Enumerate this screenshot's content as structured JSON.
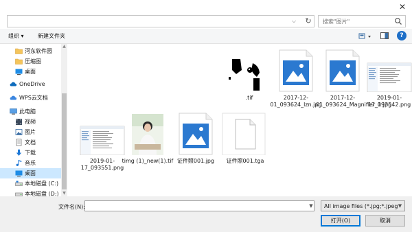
{
  "window": {
    "close_glyph": "✕"
  },
  "address": {
    "dropdown_glyph": "⌵",
    "refresh_glyph": "↻"
  },
  "search": {
    "placeholder": "搜索\"图片\""
  },
  "toolbar": {
    "organize": "组织 ▾",
    "new_folder": "新建文件夹",
    "help": "?"
  },
  "nav": {
    "items": [
      {
        "label": "河东软件园",
        "icon": "folder-icon"
      },
      {
        "label": "压缩图",
        "icon": "folder-icon"
      },
      {
        "label": "桌面",
        "icon": "desktop-icon"
      },
      {
        "label": "OneDrive",
        "icon": "cloud-icon"
      },
      {
        "label": "WPS云文档",
        "icon": "wps-cloud-icon"
      },
      {
        "label": "此电脑",
        "icon": "computer-icon"
      },
      {
        "label": "视频",
        "icon": "video-icon"
      },
      {
        "label": "图片",
        "icon": "pictures-icon"
      },
      {
        "label": "文档",
        "icon": "documents-icon"
      },
      {
        "label": "下载",
        "icon": "download-icon"
      },
      {
        "label": "音乐",
        "icon": "music-icon"
      },
      {
        "label": "桌面",
        "icon": "desktop-icon",
        "selected": true
      },
      {
        "label": "本地磁盘 (C:)",
        "icon": "drive-icon"
      },
      {
        "label": "本地磁盘 (D:)",
        "icon": "drive-icon"
      }
    ]
  },
  "files": [
    {
      "name": ".tif",
      "kind": "tif-image"
    },
    {
      "name": "2017-12-01_093624_lzn.jpg",
      "kind": "photo-icon"
    },
    {
      "name": "2017-12-01_093624_Magnifier_1.jpg",
      "kind": "photo-icon"
    },
    {
      "name": "2019-01-17_093542.png",
      "kind": "screenshot"
    },
    {
      "name": "2019-01-17_093551.png",
      "kind": "screenshot"
    },
    {
      "name": "timg (1)_new(1).tif",
      "kind": "portrait"
    },
    {
      "name": "证件照001.jpg",
      "kind": "photo-icon"
    },
    {
      "name": "证件照001.tga",
      "kind": "generic-file"
    }
  ],
  "bottom": {
    "filename_label": "文件名(N):",
    "filename_value": "",
    "filter_value": "All image files (*.jpg;*.jpeg;*.",
    "open_label": "打开(O)",
    "cancel_label": "取消"
  },
  "colors": {
    "accent": "#0078d7",
    "selection": "#cce8ff",
    "photo_blue": "#2b79d0"
  }
}
